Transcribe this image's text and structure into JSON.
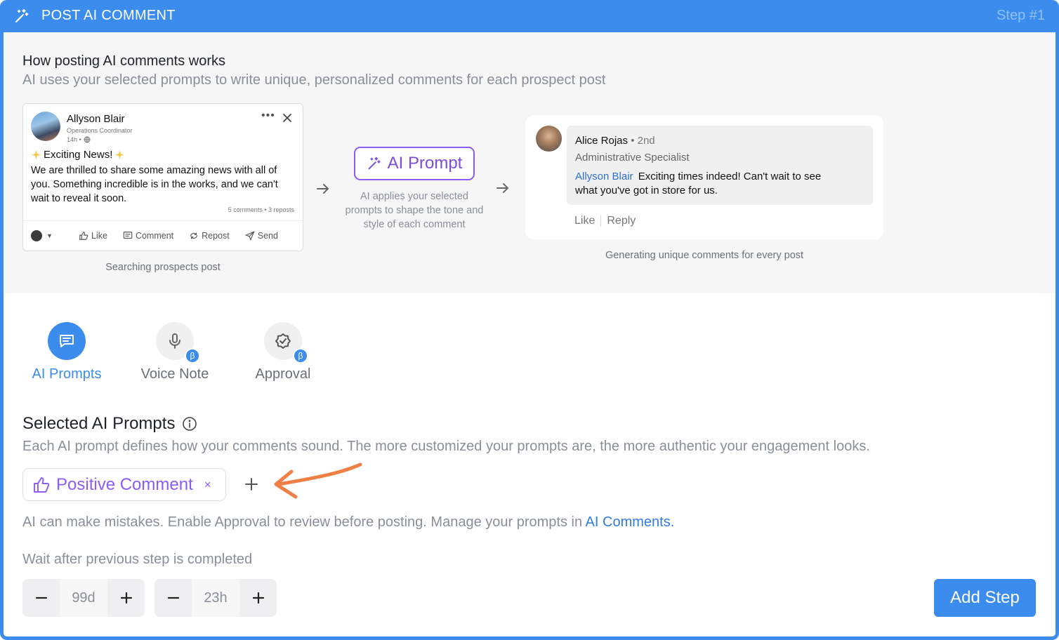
{
  "header": {
    "title": "POST AI COMMENT",
    "step": "Step #1",
    "icon": "magic-wand-icon"
  },
  "explainer": {
    "heading": "How posting AI comments works",
    "subheading": "AI uses your selected prompts to write unique, personalized comments for each prospect post",
    "post": {
      "author": "Allyson Blair",
      "role": "Operations Coordinator",
      "time": "14h •",
      "headline": "Exciting News!",
      "body": "We are thrilled to share some amazing news with all of you. Something incredible is in the works, and we can't wait to reveal it soon.",
      "stats": "5 comments • 3 reposts",
      "actions": [
        "Like",
        "Comment",
        "Repost",
        "Send"
      ]
    },
    "post_caption": "Searching prospects post",
    "ai_prompt": {
      "label": "AI Prompt",
      "description": "AI applies your selected prompts to shape the tone and style of each comment"
    },
    "comment": {
      "author": "Alice Rojas",
      "degree": "• 2nd",
      "role": "Administrative Specialist",
      "mention": "Allyson Blair",
      "text": "Exciting times indeed! Can't wait to see what you've got in store for us.",
      "like": "Like",
      "reply": "Reply"
    },
    "comment_caption": "Generating unique comments for every post"
  },
  "tabs": [
    {
      "label": "AI Prompts",
      "icon": "chat-lines-icon",
      "active": true
    },
    {
      "label": "Voice Note",
      "icon": "microphone-icon",
      "badge": "β"
    },
    {
      "label": "Approval",
      "icon": "check-badge-icon",
      "badge": "β"
    }
  ],
  "selected": {
    "title": "Selected AI Prompts",
    "description": "Each AI prompt defines how your comments sound. The more customized your prompts are, the more authentic your engagement looks.",
    "chip_label": "Positive Comment",
    "chip_remove": "×"
  },
  "note": {
    "text": "AI can make mistakes. Enable Approval to review before posting. Manage your prompts in ",
    "link": "AI Comments",
    "end": "."
  },
  "wait": {
    "label": "Wait after previous step is completed",
    "days": "99d",
    "hours": "23h"
  },
  "add_step": "Add Step",
  "colors": {
    "accent": "#3b8ced",
    "purple": "#8b5cf6",
    "annotation": "#f07f45"
  }
}
